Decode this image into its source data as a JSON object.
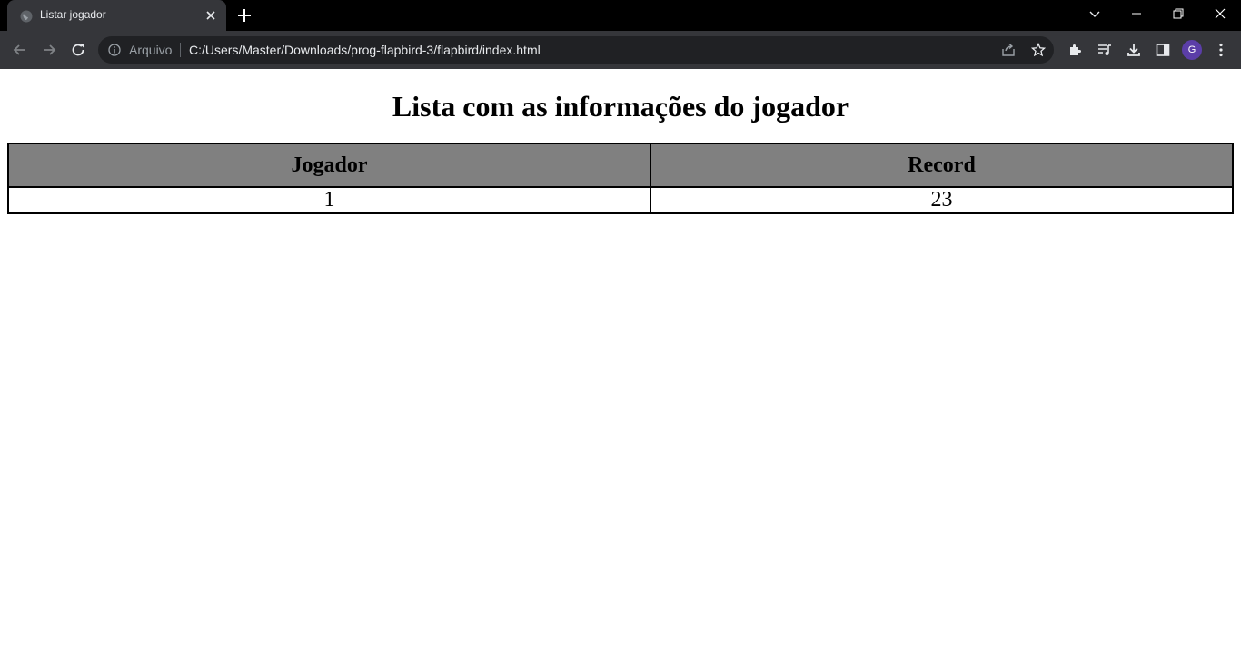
{
  "browser": {
    "tab": {
      "title": "Listar jogador"
    },
    "address_bar": {
      "scheme_label": "Arquivo",
      "url": "C:/Users/Master/Downloads/prog-flapbird-3/flapbird/index.html"
    },
    "profile_initial": "G"
  },
  "page": {
    "heading": "Lista com as informações do jogador",
    "table": {
      "headers": [
        "Jogador",
        "Record"
      ],
      "rows": [
        [
          "1",
          "23"
        ]
      ]
    }
  }
}
